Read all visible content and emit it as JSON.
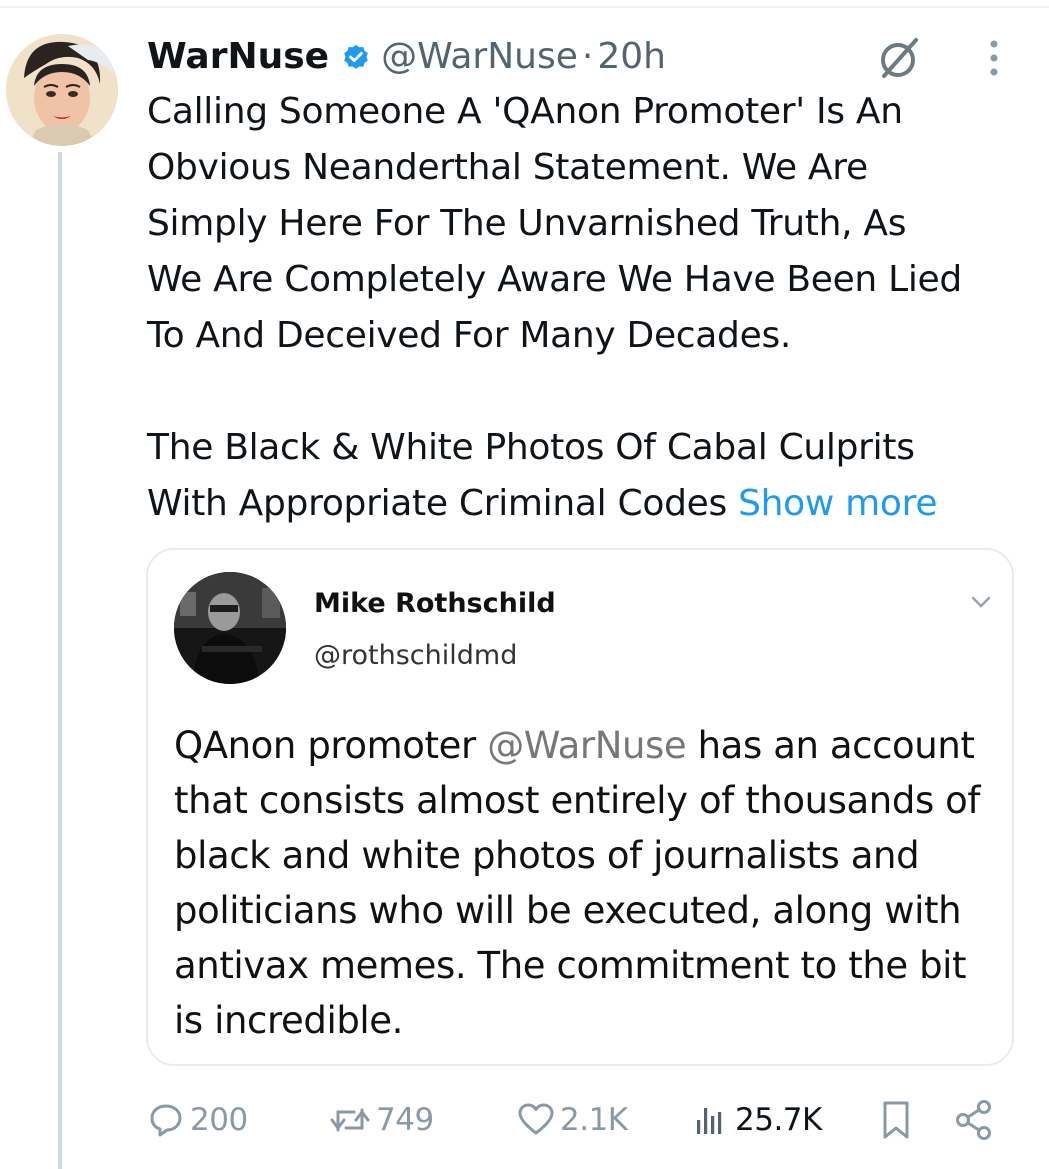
{
  "tweet": {
    "display_name": "WarNuse",
    "handle": "@WarNuse",
    "separator": "·",
    "time": "20h",
    "text_para1": "Calling Someone A 'QAnon Promoter' Is An\nObvious Neanderthal Statement. We Are\nSimply Here For The Unvarnished Truth, As\nWe Are Completely Aware We Have Been Lied\nTo And Deceived For Many Decades.",
    "text_para2": "The Black & White Photos Of Cabal Culprits\nWith Appropriate Criminal Codes ",
    "show_more": "Show more"
  },
  "quote": {
    "display_name": "Mike Rothschild",
    "handle": "@rothschildmd",
    "text_prefix": "QAnon promoter ",
    "mention": "@WarNuse",
    "text_suffix": " has an account that consists almost entirely of thousands of black and white photos of journalists and politicians who will be executed, along with antivax memes. The commitment to the bit is incredible."
  },
  "actions": {
    "replies": "200",
    "reposts": "749",
    "likes": "2.1K",
    "views": "25.7K"
  },
  "icons": {
    "verified": "verified-badge-icon",
    "grok": "grok-icon",
    "more": "more-options-icon",
    "reply": "reply-icon",
    "repost": "repost-icon",
    "like": "heart-icon",
    "views": "analytics-icon",
    "bookmark": "bookmark-icon",
    "share": "share-icon"
  },
  "colors": {
    "link": "#1d9bf0",
    "verified": "#1d9bf0",
    "muted": "#536471",
    "action_muted": "#8a99a6"
  }
}
